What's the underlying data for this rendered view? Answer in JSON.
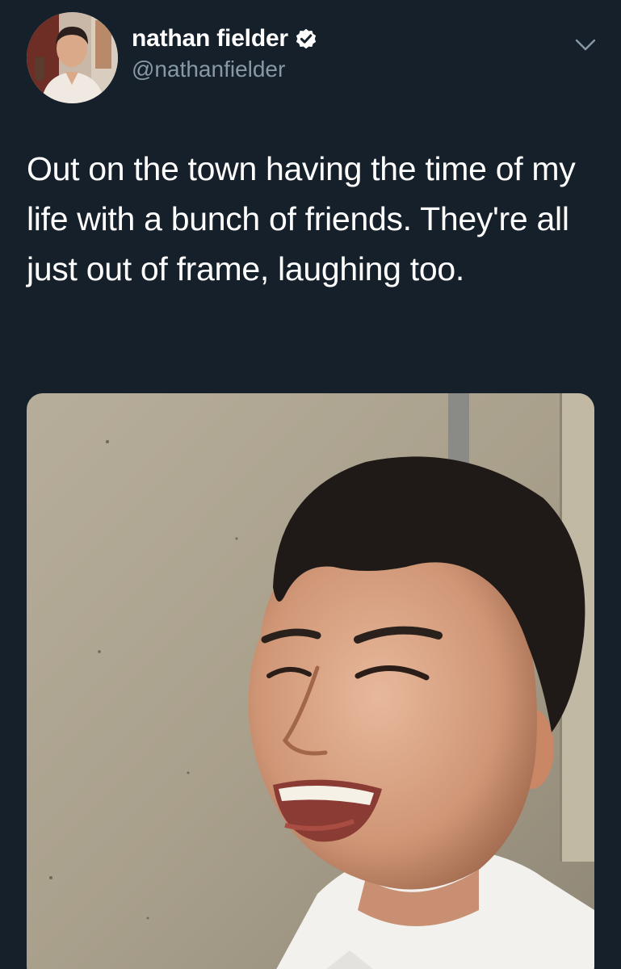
{
  "author": {
    "display_name": "nathan fielder",
    "handle": "@nathanfielder",
    "verified": true,
    "verified_icon": "verified-badge-icon",
    "avatar_icon": "profile-photo"
  },
  "menu": {
    "icon": "chevron-down-icon"
  },
  "tweet": {
    "text": "Out on the town having the time of my life with a bunch of friends. They're all just out of frame, laughing too."
  },
  "media": {
    "kind": "photo",
    "subject": "smiling-man-photo"
  },
  "colors": {
    "background": "#15202b",
    "text": "#ffffff",
    "secondary_text": "#8899a6"
  }
}
